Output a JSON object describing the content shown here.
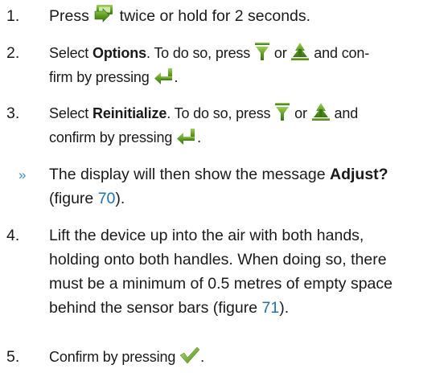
{
  "steps": [
    {
      "number": "1.",
      "line1_pre": "Press ",
      "line1_post": " twice or hold for 2 seconds."
    },
    {
      "number": "2.",
      "line1_pre": "Select ",
      "line1_bold": "Options",
      "line1_mid": ". To do so, press ",
      "line1_or": " or ",
      "line1_post": " and con-",
      "line2_pre": "firm by pressing ",
      "line2_post": "."
    },
    {
      "number": "3.",
      "line1_pre": "Select ",
      "line1_bold": "Reinitialize",
      "line1_mid": ". To do so, press ",
      "line1_or": " or ",
      "line1_post": " and",
      "line2_pre": "confirm by pressing ",
      "line2_post": "."
    },
    {
      "number": "",
      "bullet": "»",
      "line1_pre": "The display will then show the message ",
      "line1_bold": "Adjust?",
      "line2_pre": "(figure ",
      "line2_link": "70",
      "line2_post": ")."
    },
    {
      "number": "4.",
      "line1": "Lift the device up into the air with both hands,",
      "line2": "holding onto both handles. When doing so, there",
      "line3": "must be a minimum of 0.5 metres of empty space",
      "line4_pre": "behind the sensor bars (figure ",
      "line4_link": "71",
      "line4_post": ")."
    },
    {
      "number": "5.",
      "line1_pre": "Confirm by pressing ",
      "line1_post": "."
    }
  ],
  "icons": {
    "menu": "menu-icon",
    "arrow_down": "arrow-down-icon",
    "arrow_up": "arrow-up-icon",
    "enter": "enter-icon",
    "confirm": "checkmark-icon"
  },
  "colors": {
    "icon_green": "#4f8f1f",
    "link_blue": "#1f6fb5",
    "text": "#1a1a1a"
  }
}
